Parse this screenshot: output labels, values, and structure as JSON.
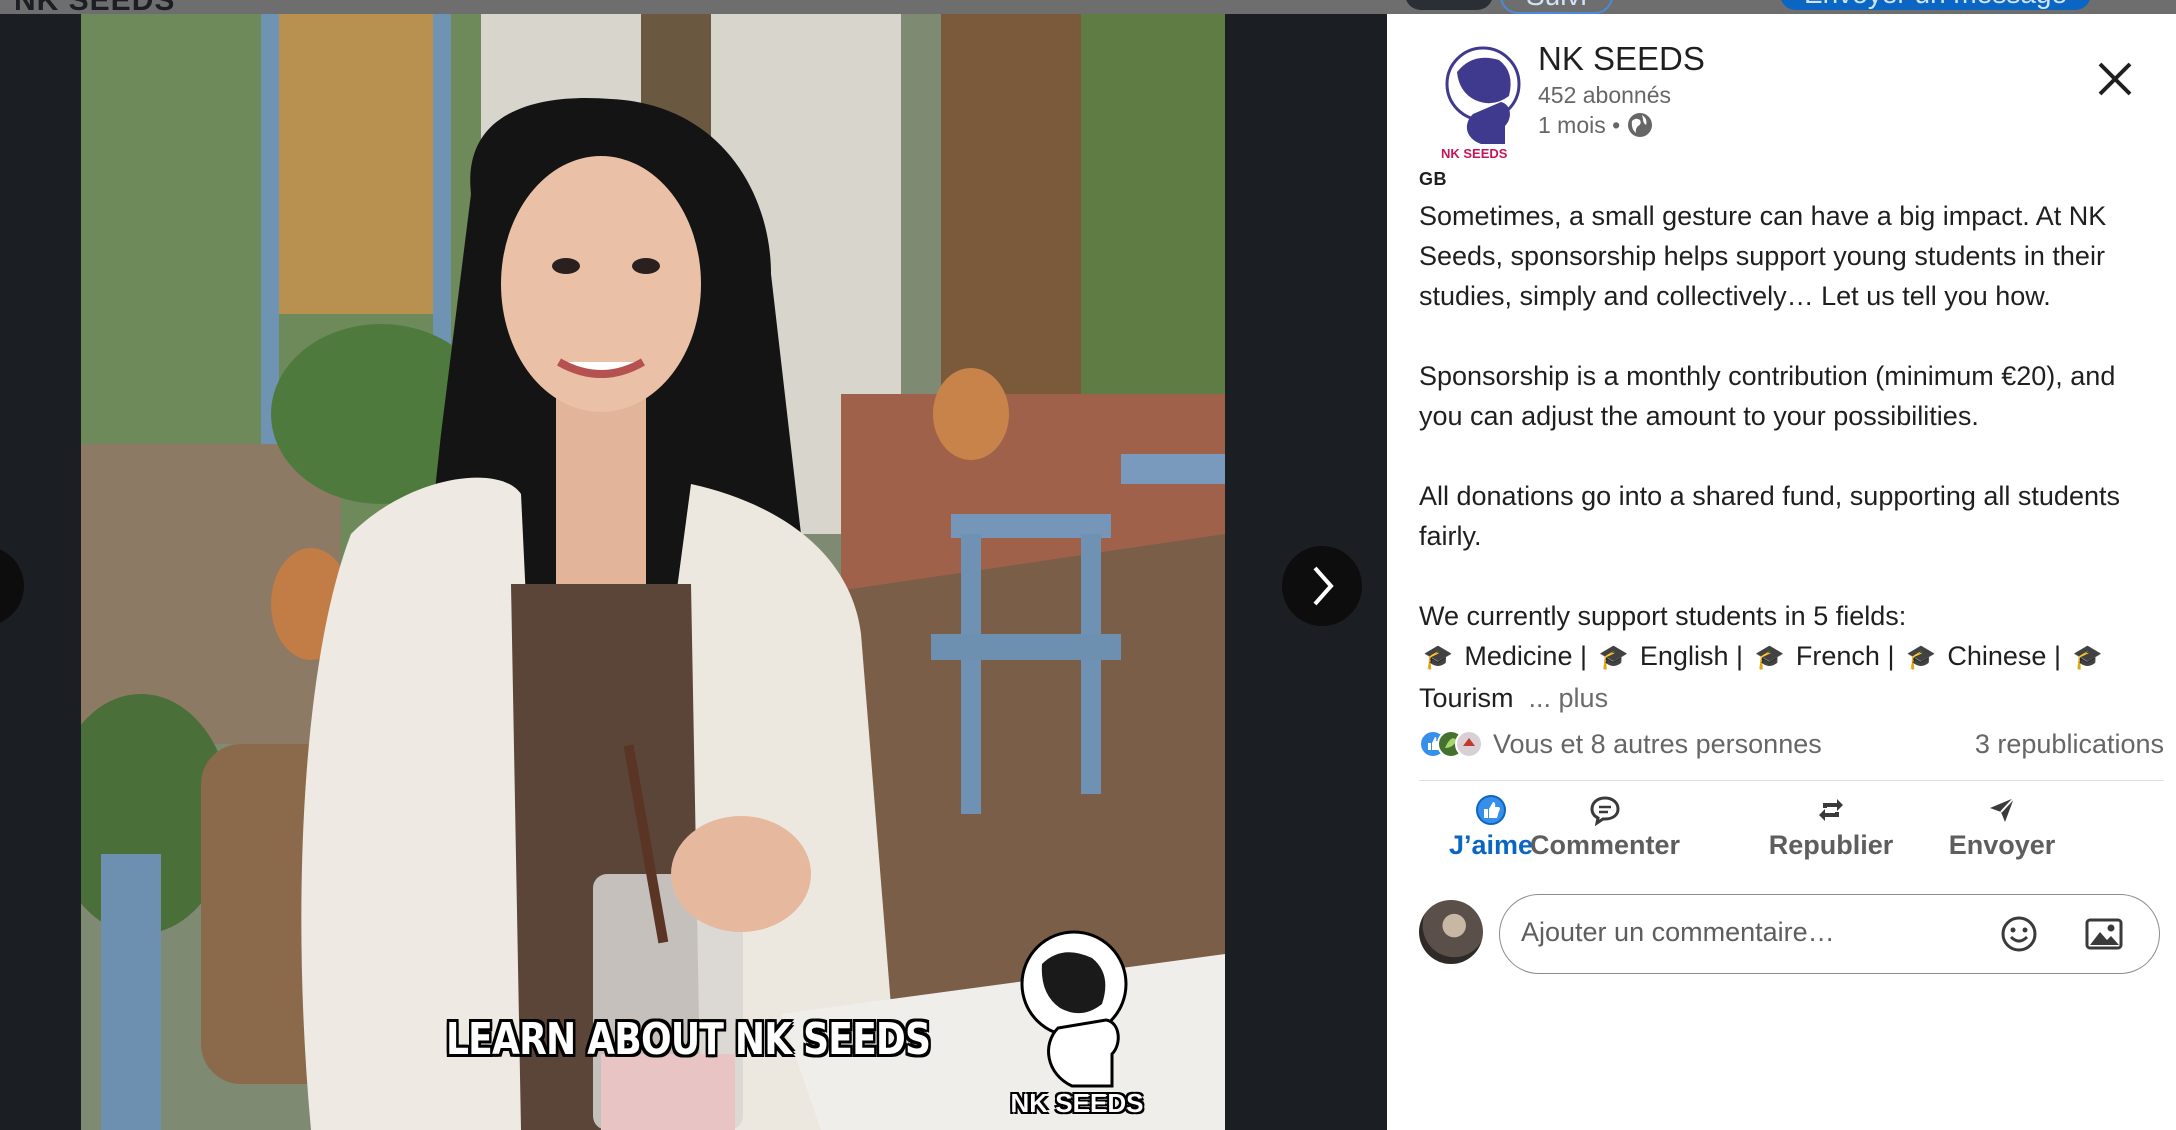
{
  "background_page": {
    "title": "NK SEEDS",
    "follow_label": "Suivi",
    "message_label": "Envoyer un message"
  },
  "media": {
    "caption": "LEARN ABOUT NK SEEDS",
    "watermark_text": "NK SEEDS"
  },
  "post": {
    "logo_text": "NK SEEDS",
    "company_name": "NK SEEDS",
    "followers": "452 abonnés",
    "time": "1 mois •",
    "language_tag": "GB",
    "paragraphs": [
      "Sometimes, a small gesture can have a big impact. At NK Seeds, sponsorship helps support young students in their studies, simply and collectively… Let us tell you how.",
      "Sponsorship is a monthly contribution (minimum €20), and you can adjust the amount to your possibilities.",
      "All donations go into a shared fund, supporting all students fairly.",
      "We currently support students in 5 fields:"
    ],
    "fields": [
      "Medicine |",
      "English |",
      "French |",
      "Chinese |",
      "Tourism"
    ],
    "field_emoji": "🎓",
    "see_more": "... plus",
    "reactions_text": "Vous et 8 autres personnes",
    "reposts_text": "3 republications"
  },
  "actions": {
    "like": "J’aime",
    "comment": "Commenter",
    "repost": "Republier",
    "send": "Envoyer"
  },
  "comment_input": {
    "placeholder": "Ajouter un commentaire…"
  },
  "colors": {
    "accent": "#0a66c2",
    "brand_purple": "#3f3a8e",
    "logo_pink": "#c2185b"
  }
}
